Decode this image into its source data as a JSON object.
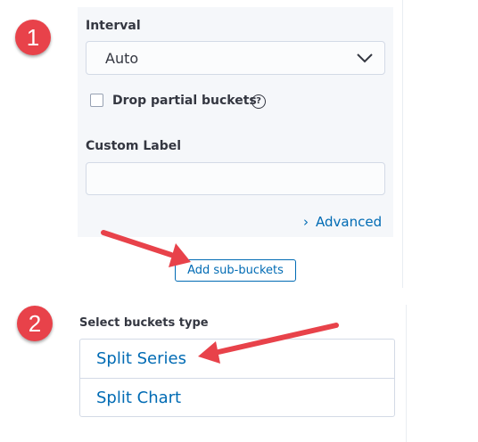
{
  "interval": {
    "label": "Interval",
    "selected": "Auto"
  },
  "drop_partial": {
    "label": "Drop partial buckets",
    "checked": false,
    "help_icon": "question-circle-icon"
  },
  "custom_label": {
    "label": "Custom Label",
    "value": ""
  },
  "advanced": {
    "caret": "›",
    "label": "Advanced"
  },
  "add_sub_buckets": {
    "label": "Add sub-buckets"
  },
  "select_buckets": {
    "label": "Select buckets type",
    "items": [
      "Split Series",
      "Split Chart"
    ]
  },
  "annotations": {
    "badges": [
      "1",
      "2"
    ],
    "color": "#e8424a"
  },
  "colors": {
    "accent": "#006bb4",
    "panel_bg": "#f5f7fa",
    "border": "#d3dae6"
  }
}
